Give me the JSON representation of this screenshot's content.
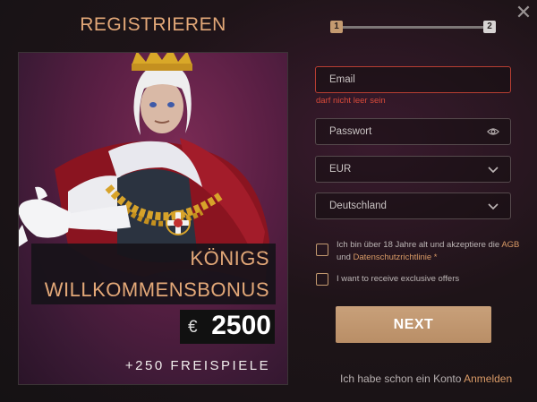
{
  "header": {
    "title": "REGISTRIEREN",
    "close": "✕"
  },
  "progress": {
    "step1": "1",
    "step2": "2",
    "current": 1,
    "total": 2
  },
  "promo": {
    "line1": "KÖNIGS",
    "line2": "WILLKOMMENSBONUS",
    "currency": "€",
    "amount": "2500",
    "spins": "+250 FREISPIELE"
  },
  "form": {
    "email_placeholder": "Email",
    "email_error": "darf nicht leer sein",
    "password_placeholder": "Passwort",
    "currency_value": "EUR",
    "country_value": "Deutschland",
    "terms_prefix": "Ich bin über 18 Jahre alt und akzeptiere die",
    "terms_agb": "AGB",
    "terms_and": "und",
    "terms_privacy": "Datenschutzrichtlinie",
    "terms_required": "*",
    "offers_label": "I want to receive exclusive offers",
    "next_label": "NEXT"
  },
  "footer": {
    "have_account": "Ich habe schon ein Konto",
    "login_link": "Anmelden"
  },
  "colors": {
    "accent": "#c49a70",
    "error": "#d84a3a",
    "title": "#e3a878"
  }
}
